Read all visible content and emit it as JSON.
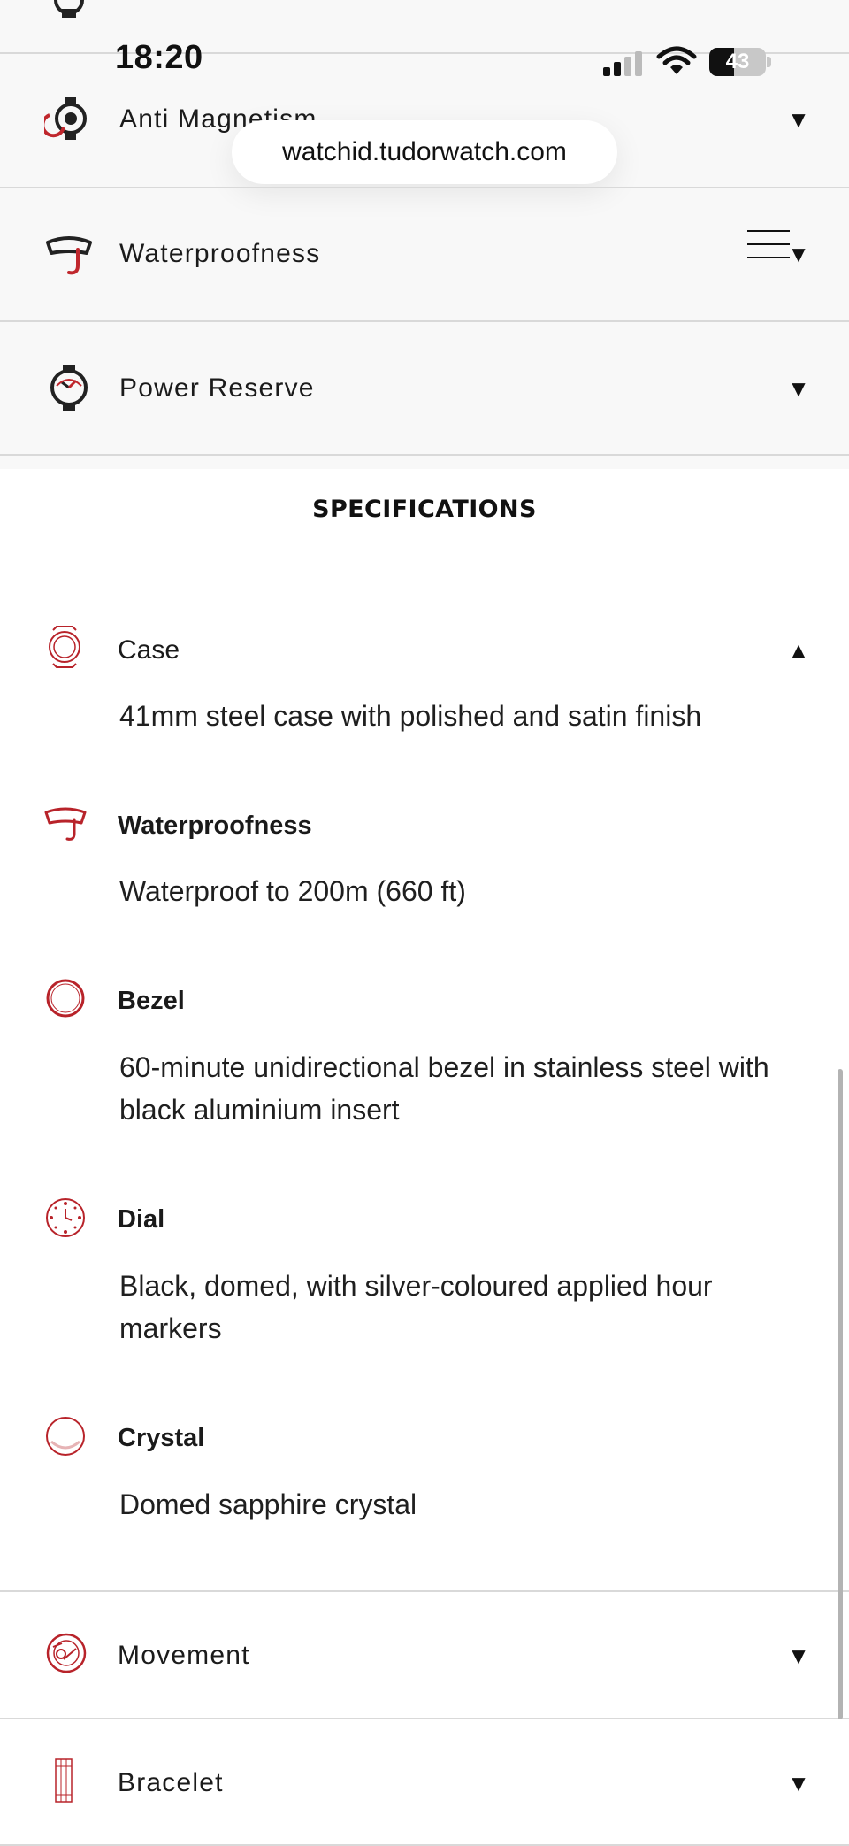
{
  "status_bar": {
    "time": "18:20",
    "battery": "43"
  },
  "browser": {
    "url": "watchid.tudorwatch.com"
  },
  "features": [
    {
      "label": "Anti Magnetism",
      "icon": "anti-magnetism-icon"
    },
    {
      "label": "Waterproofness",
      "icon": "waterproofness-icon"
    },
    {
      "label": "Power Reserve",
      "icon": "power-reserve-icon"
    }
  ],
  "specifications": {
    "title": "SPECIFICATIONS",
    "case": {
      "label": "Case",
      "value": "41mm steel case with polished and satin finish"
    },
    "waterproofness": {
      "label": "Waterproofness",
      "value": "Waterproof to 200m (660 ft)"
    },
    "bezel": {
      "label": "Bezel",
      "value": "60-minute unidirectional bezel in stainless steel with black aluminium insert"
    },
    "dial": {
      "label": "Dial",
      "value": "Black, domed, with silver-coloured applied hour markers"
    },
    "crystal": {
      "label": "Crystal",
      "value": "Domed sapphire crystal"
    }
  },
  "more": [
    {
      "label": "Movement",
      "icon": "movement-icon"
    },
    {
      "label": "Bracelet",
      "icon": "bracelet-icon"
    }
  ],
  "colors": {
    "accent_red": "#b8232a",
    "band_gray": "#f8f8f8",
    "divider": "#d9d9d9"
  }
}
